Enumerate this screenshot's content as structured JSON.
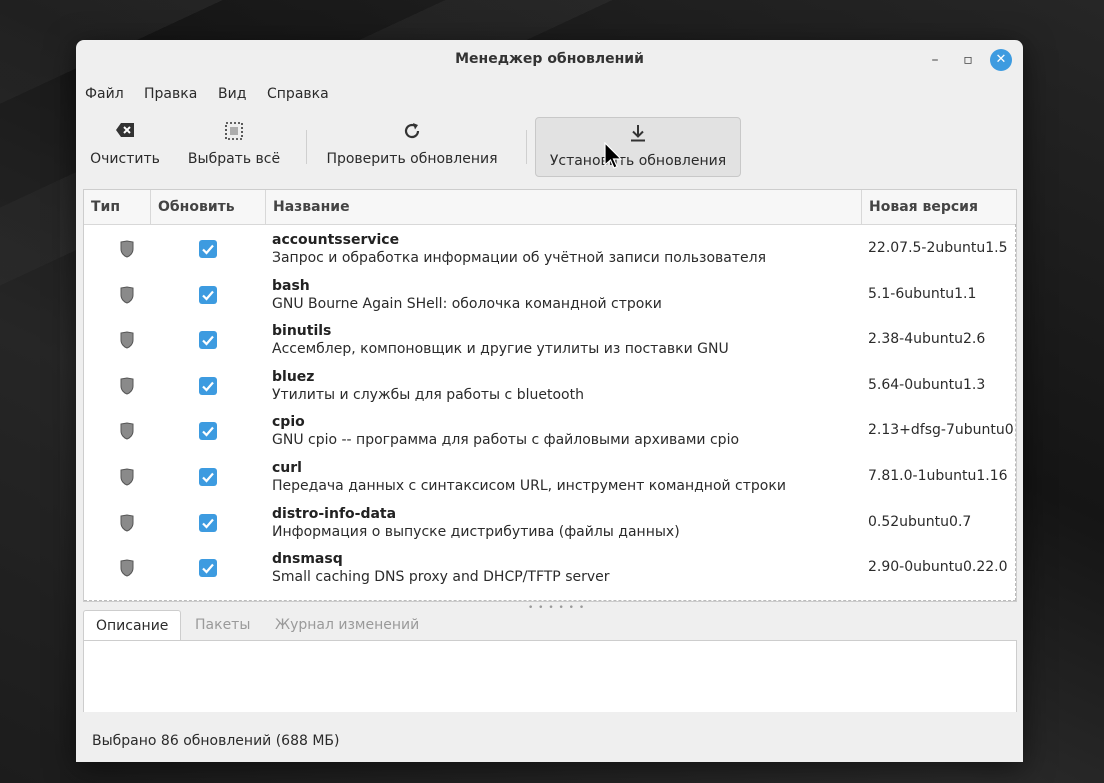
{
  "window": {
    "title": "Менеджер обновлений",
    "controls": {
      "minimize": "–",
      "maximize": "▫",
      "close": "✕"
    }
  },
  "menu": [
    "Файл",
    "Правка",
    "Вид",
    "Справка"
  ],
  "toolbar": {
    "clear_label": "Очистить",
    "select_all_label": "Выбрать всё",
    "refresh_label": "Проверить обновления",
    "install_label": "Установить обновления"
  },
  "table": {
    "columns": [
      "Тип",
      "Обновить",
      "Название",
      "Новая версия"
    ],
    "rows": [
      {
        "name": "accountsservice",
        "desc": "Запрос и обработка информации об учётной записи пользователя",
        "version": "22.07.5-2ubuntu1.5"
      },
      {
        "name": "bash",
        "desc": "GNU Bourne Again SHell: оболочка командной строки",
        "version": "5.1-6ubuntu1.1"
      },
      {
        "name": "binutils",
        "desc": "Ассемблер, компоновщик и другие утилиты из поставки GNU",
        "version": "2.38-4ubuntu2.6"
      },
      {
        "name": "bluez",
        "desc": "Утилиты и службы для работы с bluetooth",
        "version": "5.64-0ubuntu1.3"
      },
      {
        "name": "cpio",
        "desc": "GNU cpio -- программа для работы с файловыми архивами cpio",
        "version": "2.13+dfsg-7ubuntu0"
      },
      {
        "name": "curl",
        "desc": "Передача данных с синтаксисом URL, инструмент командной строки",
        "version": "7.81.0-1ubuntu1.16"
      },
      {
        "name": "distro-info-data",
        "desc": "Информация о выпуске дистрибутива (файлы данных)",
        "version": "0.52ubuntu0.7"
      },
      {
        "name": "dnsmasq",
        "desc": "Small caching DNS proxy and DHCP/TFTP server",
        "version": "2.90-0ubuntu0.22.0"
      }
    ]
  },
  "tabs": [
    "Описание",
    "Пакеты",
    "Журнал изменений"
  ],
  "status": "Выбрано 86 обновлений (688 МБ)",
  "colors": {
    "accent": "#3d9be0",
    "window_bg": "#efefef"
  }
}
